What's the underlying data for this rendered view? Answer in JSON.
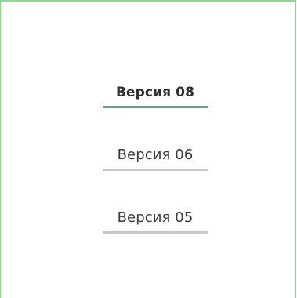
{
  "versions": {
    "items": [
      {
        "label": "Версия 08",
        "active": true
      },
      {
        "label": "Версия 06",
        "active": false
      },
      {
        "label": "Версия 05",
        "active": false
      }
    ]
  },
  "colors": {
    "panel_border": "#8ed98e",
    "active_underline": "#5fa57d",
    "inactive_underline": "#c8c8c8"
  }
}
